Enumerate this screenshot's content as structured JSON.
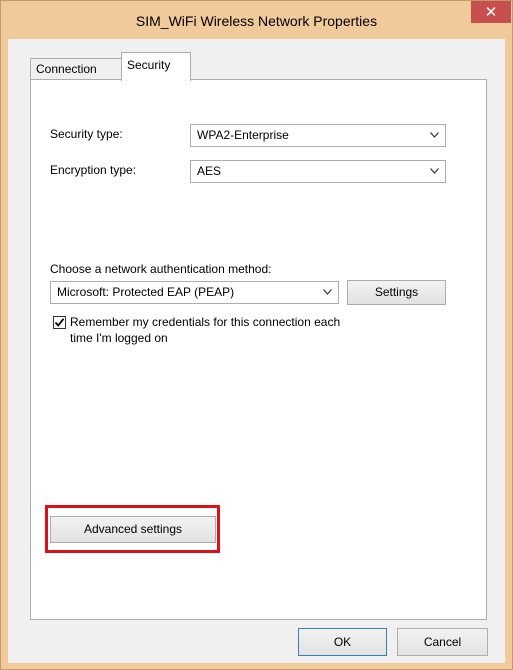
{
  "window": {
    "title": "SIM_WiFi Wireless Network Properties",
    "close_glyph": "✕"
  },
  "tabs": [
    {
      "label": "Connection",
      "active": false
    },
    {
      "label": "Security",
      "active": true
    }
  ],
  "security": {
    "security_type_label": "Security type:",
    "security_type_value": "WPA2-Enterprise",
    "encryption_type_label": "Encryption type:",
    "encryption_type_value": "AES",
    "auth_method_label": "Choose a network authentication method:",
    "auth_method_value": "Microsoft: Protected EAP (PEAP)",
    "settings_button": "Settings",
    "remember_label_line1": "Remember my credentials for this connection each",
    "remember_label_line2": "time I'm logged on",
    "remember_checked": true,
    "advanced_button": "Advanced settings"
  },
  "footer": {
    "ok_button": "OK",
    "cancel_button": "Cancel"
  },
  "icons": {
    "dropdown": "chevron-down-icon",
    "checkmark": "checkmark-icon",
    "close": "close-icon"
  },
  "colors": {
    "window_frame": "#f1ca9b",
    "close_button": "#c7504f",
    "highlight": "#d9121a"
  }
}
